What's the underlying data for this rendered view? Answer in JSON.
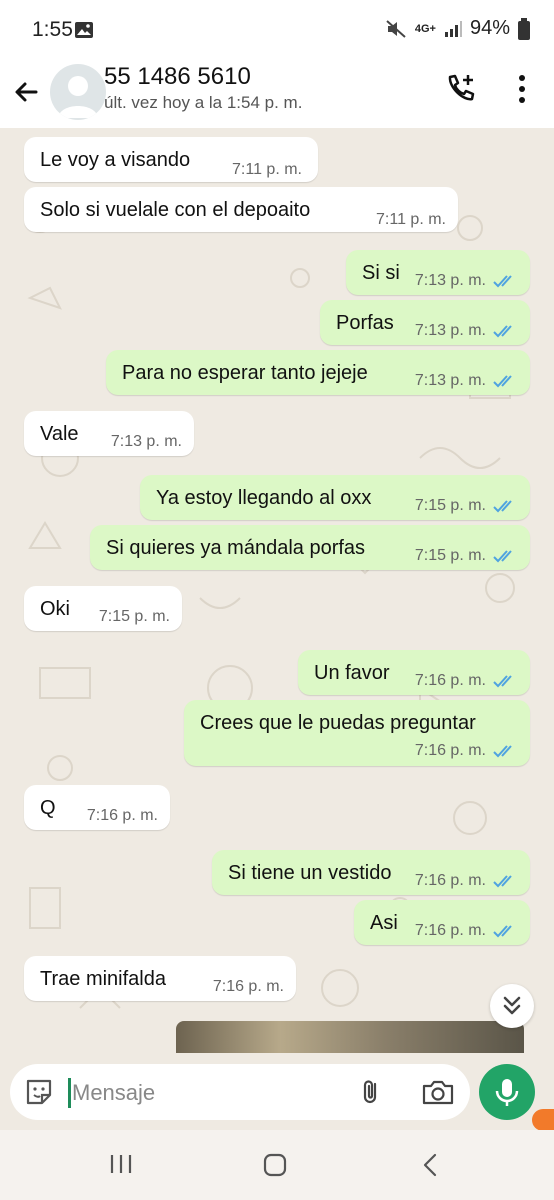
{
  "status_bar": {
    "time": "1:55",
    "network": "4G+",
    "battery": "94%"
  },
  "header": {
    "contact_name": "55 1486 5610",
    "last_seen": "últ. vez hoy a la 1:54 p. m."
  },
  "messages": [
    {
      "dir": "in",
      "text": "Le voy a visando",
      "time": "7:11 p. m."
    },
    {
      "dir": "in",
      "text": "Solo si vuelale con el depoaito",
      "time": "7:11 p. m."
    },
    {
      "dir": "out",
      "text": "Si si",
      "time": "7:13 p. m."
    },
    {
      "dir": "out",
      "text": "Porfas",
      "time": "7:13 p. m."
    },
    {
      "dir": "out",
      "text": "Para no esperar tanto jejeje",
      "time": "7:13 p. m."
    },
    {
      "dir": "in",
      "text": "Vale",
      "time": "7:13 p. m."
    },
    {
      "dir": "out",
      "text": "Ya estoy llegando al oxx",
      "time": "7:15 p. m."
    },
    {
      "dir": "out",
      "text": "Si quieres ya mándala porfas",
      "time": "7:15 p. m."
    },
    {
      "dir": "in",
      "text": "Oki",
      "time": "7:15 p. m."
    },
    {
      "dir": "out",
      "text": "Un favor",
      "time": "7:16 p. m."
    },
    {
      "dir": "out",
      "text": "Crees que le puedas preguntar",
      "time": "7:16 p. m."
    },
    {
      "dir": "in",
      "text": "Q",
      "time": "7:16 p. m."
    },
    {
      "dir": "out",
      "text": "Si tiene un vestido",
      "time": "7:16 p. m."
    },
    {
      "dir": "out",
      "text": "Asi",
      "time": "7:16 p. m."
    },
    {
      "dir": "in",
      "text": "Trae minifalda",
      "time": "7:16 p. m."
    }
  ],
  "composer": {
    "placeholder": "Mensaje"
  },
  "colors": {
    "outgoing_bubble": "#dcf8c6",
    "incoming_bubble": "#ffffff",
    "read_ticks": "#4fa3e0",
    "mic_button": "#22a467"
  }
}
